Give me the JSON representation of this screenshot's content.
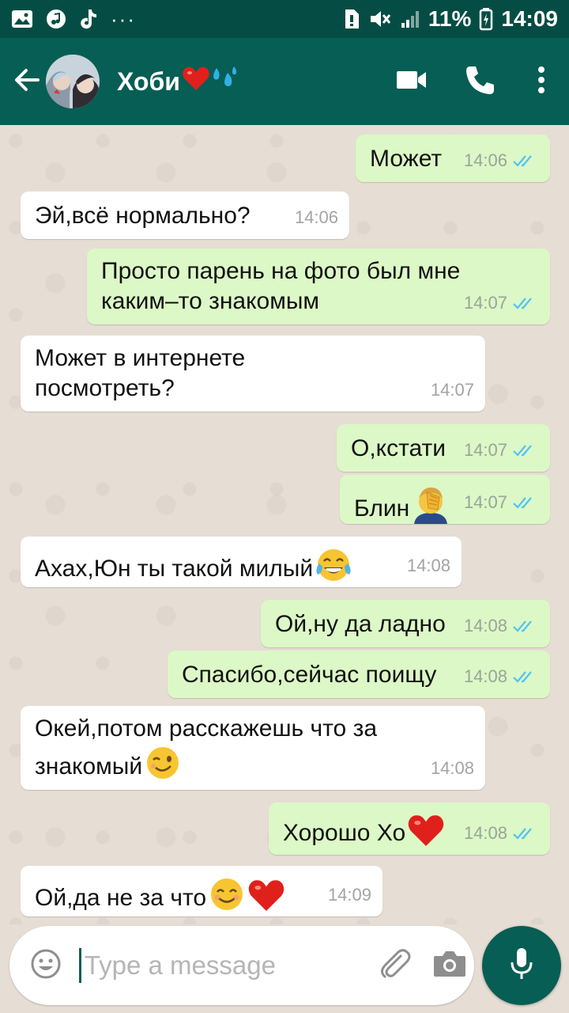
{
  "status_bar": {
    "battery": "11%",
    "time": "14:09",
    "more": "···"
  },
  "header": {
    "contact_name": "Хоби",
    "icons": [
      "back-arrow-icon",
      "video-call-icon",
      "phone-icon",
      "more-vert-icon"
    ]
  },
  "messages": [
    {
      "dir": "out",
      "text": "Может",
      "time": "14:06"
    },
    {
      "dir": "in",
      "text": "Эй,всё нормально?",
      "time": "14:06"
    },
    {
      "dir": "out",
      "text": "Просто парень на фото был мне каким–то знакомым",
      "time": "14:07"
    },
    {
      "dir": "in",
      "text": "Может в интернете посмотреть?",
      "time": "14:07"
    },
    {
      "dir": "out",
      "text": "О,кстати",
      "time": "14:07"
    },
    {
      "dir": "out",
      "text": "Блин",
      "time": "14:07",
      "emoji": "facepalm"
    },
    {
      "dir": "in",
      "text": "Ахах,Юн ты такой милый",
      "time": "14:08",
      "emoji": "tears-of-joy"
    },
    {
      "dir": "out",
      "text": "Ой,ну да ладно",
      "time": "14:08"
    },
    {
      "dir": "out",
      "text": "Спасибо,сейчас поищу",
      "time": "14:08"
    },
    {
      "dir": "in",
      "text": "Окей,потом расскажешь что за знакомый",
      "time": "14:08",
      "emoji": "wink"
    },
    {
      "dir": "out",
      "text": "Хорошо Хо",
      "time": "14:08",
      "emoji": "heart"
    },
    {
      "dir": "in",
      "text": "Ой,да не за что",
      "time": "14:09",
      "emoji": "smile-heart"
    }
  ],
  "input": {
    "placeholder": "Type a message"
  },
  "colors": {
    "header": "#075e54",
    "status": "#054d44",
    "outgoing": "#dcf8c6",
    "incoming": "#ffffff",
    "read_ticks": "#4fc3f7"
  }
}
